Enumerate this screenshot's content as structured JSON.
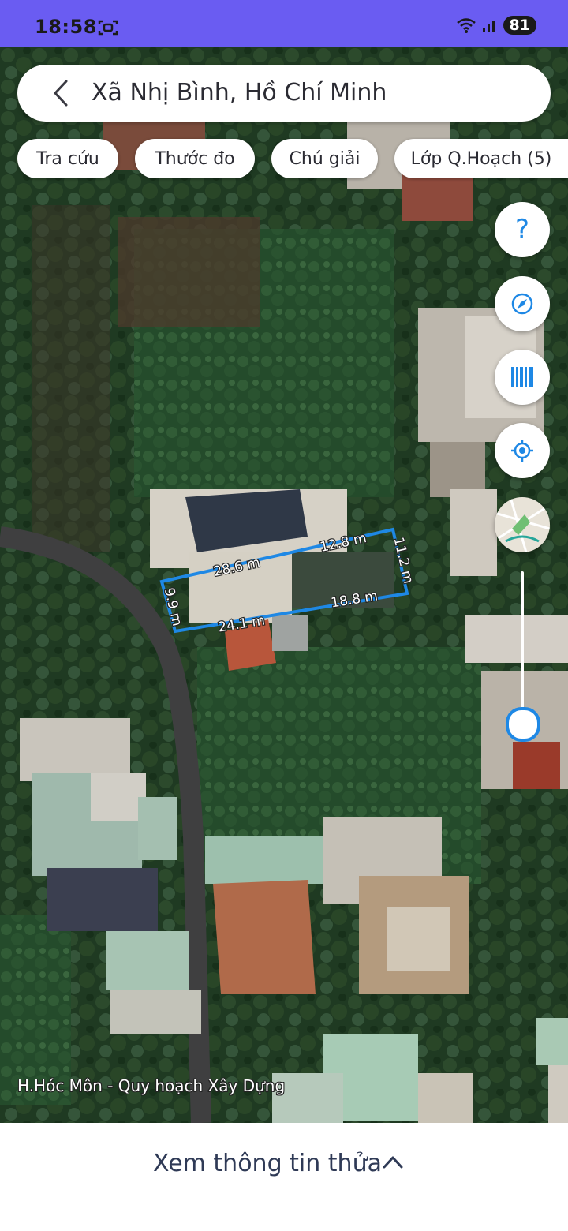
{
  "status_bar": {
    "time": "18:58",
    "battery": "81",
    "icons": [
      "screen-record-icon",
      "wifi-icon",
      "signal-icon",
      "battery-icon"
    ]
  },
  "search": {
    "location": "Xã Nhị Bình, Hồ Chí Minh"
  },
  "chips": [
    {
      "label": "Tra cứu"
    },
    {
      "label": "Thước đo"
    },
    {
      "label": "Chú giải"
    },
    {
      "label": "Lớp Q.Hoạch (5)"
    }
  ],
  "side_buttons": {
    "help_label": "?",
    "icons": [
      "help-icon",
      "compass-icon",
      "barcode-icon",
      "locate-icon",
      "minimap-thumbnail"
    ]
  },
  "map": {
    "watermark": "H.Hóc Môn - Quy hoạch Xây Dựng",
    "measurements": [
      "28.6 m",
      "12.8 m",
      "11.2 m",
      "9.9 m",
      "24.1 m",
      "18.8 m"
    ]
  },
  "bottom": {
    "label": "Xem thông tin thửa"
  },
  "colors": {
    "status_bar": "#6a5cf2",
    "accent": "#1e88e5",
    "text": "#2b2b33"
  }
}
